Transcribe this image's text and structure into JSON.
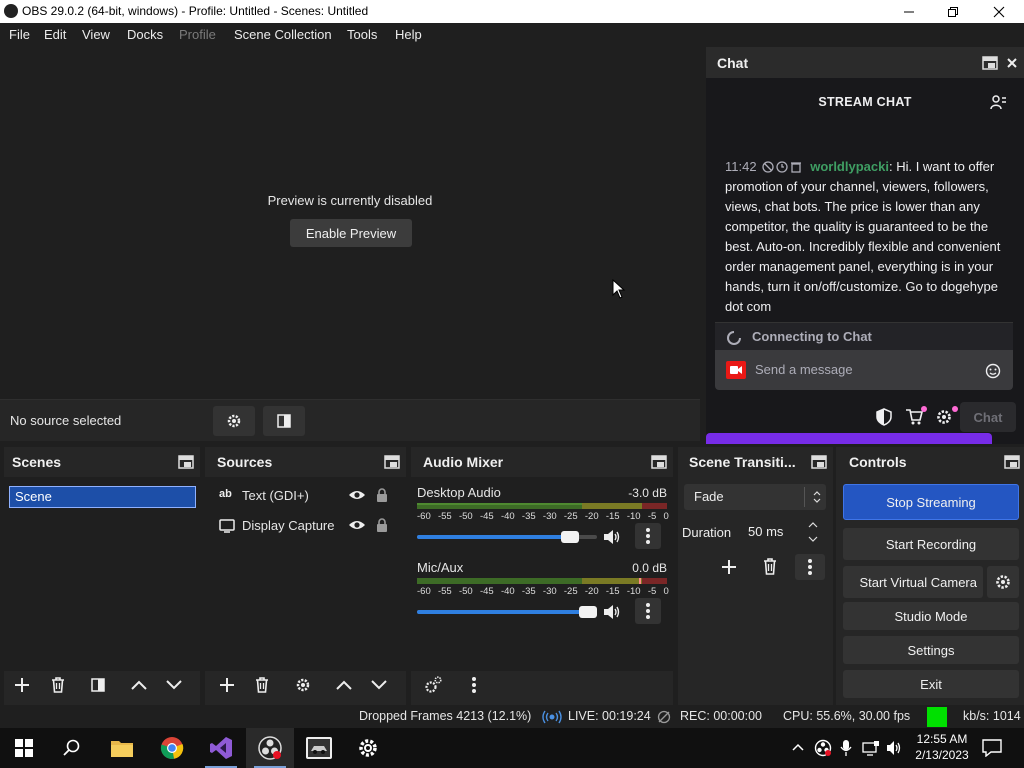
{
  "window": {
    "title": "OBS 29.0.2 (64-bit, windows) - Profile: Untitled - Scenes: Untitled",
    "controls": [
      "minimize",
      "maximize",
      "close"
    ]
  },
  "menu": {
    "file": "File",
    "edit": "Edit",
    "view": "View",
    "docks": "Docks",
    "profile": "Profile",
    "scene_collection": "Scene Collection",
    "tools": "Tools",
    "help": "Help"
  },
  "preview": {
    "message": "Preview is currently disabled",
    "enable_button": "Enable Preview"
  },
  "source_toolbar": {
    "status": "No source selected"
  },
  "chat": {
    "dock_title": "Chat",
    "header": "STREAM CHAT",
    "message": {
      "time": "11:42",
      "username": "worldlypacki",
      "text": "Hi. I want to offer promotion of your channel, viewers, followers, views, chat bots. The price is lower than any competitor, the quality is guaranteed to be the best. Auto-on. Incredibly flexible and convenient order management panel, everything is in your hands, turn it on/off/customize. Go to dogehype dot com"
    },
    "connecting": "Connecting to Chat",
    "input_placeholder": "Send a message",
    "send_button": "Chat"
  },
  "scenes": {
    "title": "Scenes",
    "items": [
      "Scene"
    ]
  },
  "sources": {
    "title": "Sources",
    "items": [
      {
        "label": "Text (GDI+)",
        "icon": "text-icon"
      },
      {
        "label": "Display Capture",
        "icon": "monitor-icon"
      }
    ]
  },
  "audio_mixer": {
    "title": "Audio Mixer",
    "scale": [
      "-60",
      "-55",
      "-50",
      "-45",
      "-40",
      "-35",
      "-30",
      "-25",
      "-20",
      "-15",
      "-10",
      "-5",
      "0"
    ],
    "channels": [
      {
        "name": "Desktop Audio",
        "db": "-3.0 dB",
        "volume": 0.9
      },
      {
        "name": "Mic/Aux",
        "db": "0.0 dB",
        "volume": 1.0
      }
    ]
  },
  "transitions": {
    "title": "Scene Transiti...",
    "selected": "Fade",
    "duration_label": "Duration",
    "duration_value": "50 ms"
  },
  "controls": {
    "title": "Controls",
    "stop_streaming": "Stop Streaming",
    "start_recording": "Start Recording",
    "start_virtual_camera": "Start Virtual Camera",
    "studio_mode": "Studio Mode",
    "settings": "Settings",
    "exit": "Exit"
  },
  "status": {
    "dropped_frames": "Dropped Frames 4213 (12.1%)",
    "live": "LIVE: 00:19:24",
    "rec": "REC: 00:00:00",
    "cpu": "CPU: 55.6%, 30.00 fps",
    "kbps": "kb/s: 1014",
    "health_color": "#00e000"
  },
  "taskbar": {
    "time": "12:55 AM",
    "date": "2/13/2023"
  },
  "colors": {
    "accent": "#2456c2",
    "twitch_purple": "#772ce8",
    "chat_username": "#3f9e63"
  }
}
